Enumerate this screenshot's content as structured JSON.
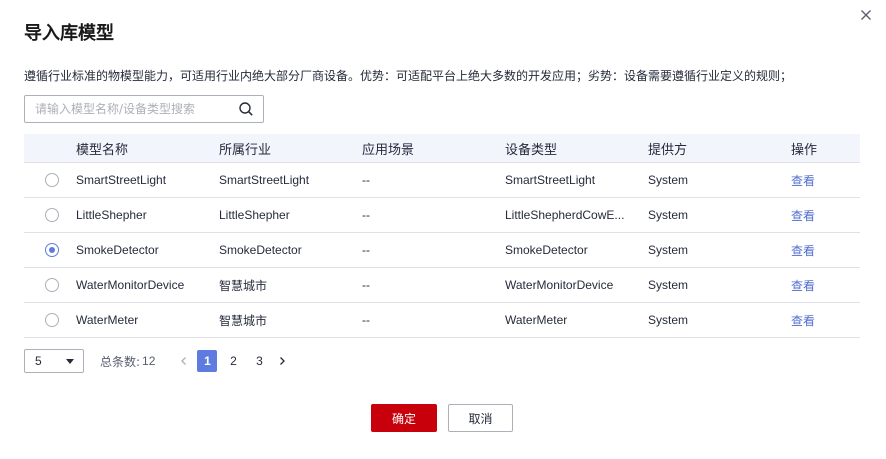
{
  "dialog": {
    "title": "导入库模型",
    "description": "遵循行业标准的物模型能力，可适用行业内绝大部分厂商设备。优势：可适配平台上绝大多数的开发应用；劣势：设备需要遵循行业定义的规则；"
  },
  "search": {
    "placeholder": "请输入模型名称/设备类型搜索",
    "value": ""
  },
  "table": {
    "headers": [
      "模型名称",
      "所属行业",
      "应用场景",
      "设备类型",
      "提供方",
      "操作"
    ],
    "rows": [
      {
        "name": "SmartStreetLight",
        "industry": "SmartStreetLight",
        "scene": "--",
        "device_type": "SmartStreetLight",
        "provider": "System",
        "action": "查看",
        "selected": false
      },
      {
        "name": "LittleShepher",
        "industry": "LittleShepher",
        "scene": "--",
        "device_type": "LittleShepherdCowE...",
        "provider": "System",
        "action": "查看",
        "selected": false
      },
      {
        "name": "SmokeDetector",
        "industry": "SmokeDetector",
        "scene": "--",
        "device_type": "SmokeDetector",
        "provider": "System",
        "action": "查看",
        "selected": true
      },
      {
        "name": "WaterMonitorDevice",
        "industry": "智慧城市",
        "scene": "--",
        "device_type": "WaterMonitorDevice",
        "provider": "System",
        "action": "查看",
        "selected": false
      },
      {
        "name": "WaterMeter",
        "industry": "智慧城市",
        "scene": "--",
        "device_type": "WaterMeter",
        "provider": "System",
        "action": "查看",
        "selected": false
      }
    ]
  },
  "pagination": {
    "page_size": "5",
    "total_label": "总条数:",
    "total": "12",
    "pages": [
      "1",
      "2",
      "3"
    ],
    "current_page": "1"
  },
  "buttons": {
    "confirm": "确定",
    "cancel": "取消"
  },
  "colors": {
    "primary_button": "#c7000b",
    "accent": "#5e7ce0",
    "link": "#526ecc",
    "header_bg": "#f2f5fc"
  },
  "icons": {
    "close": "close-icon",
    "search": "search-icon",
    "dropdown": "caret-down-icon",
    "prev": "chevron-left-icon",
    "next": "chevron-right-icon"
  }
}
